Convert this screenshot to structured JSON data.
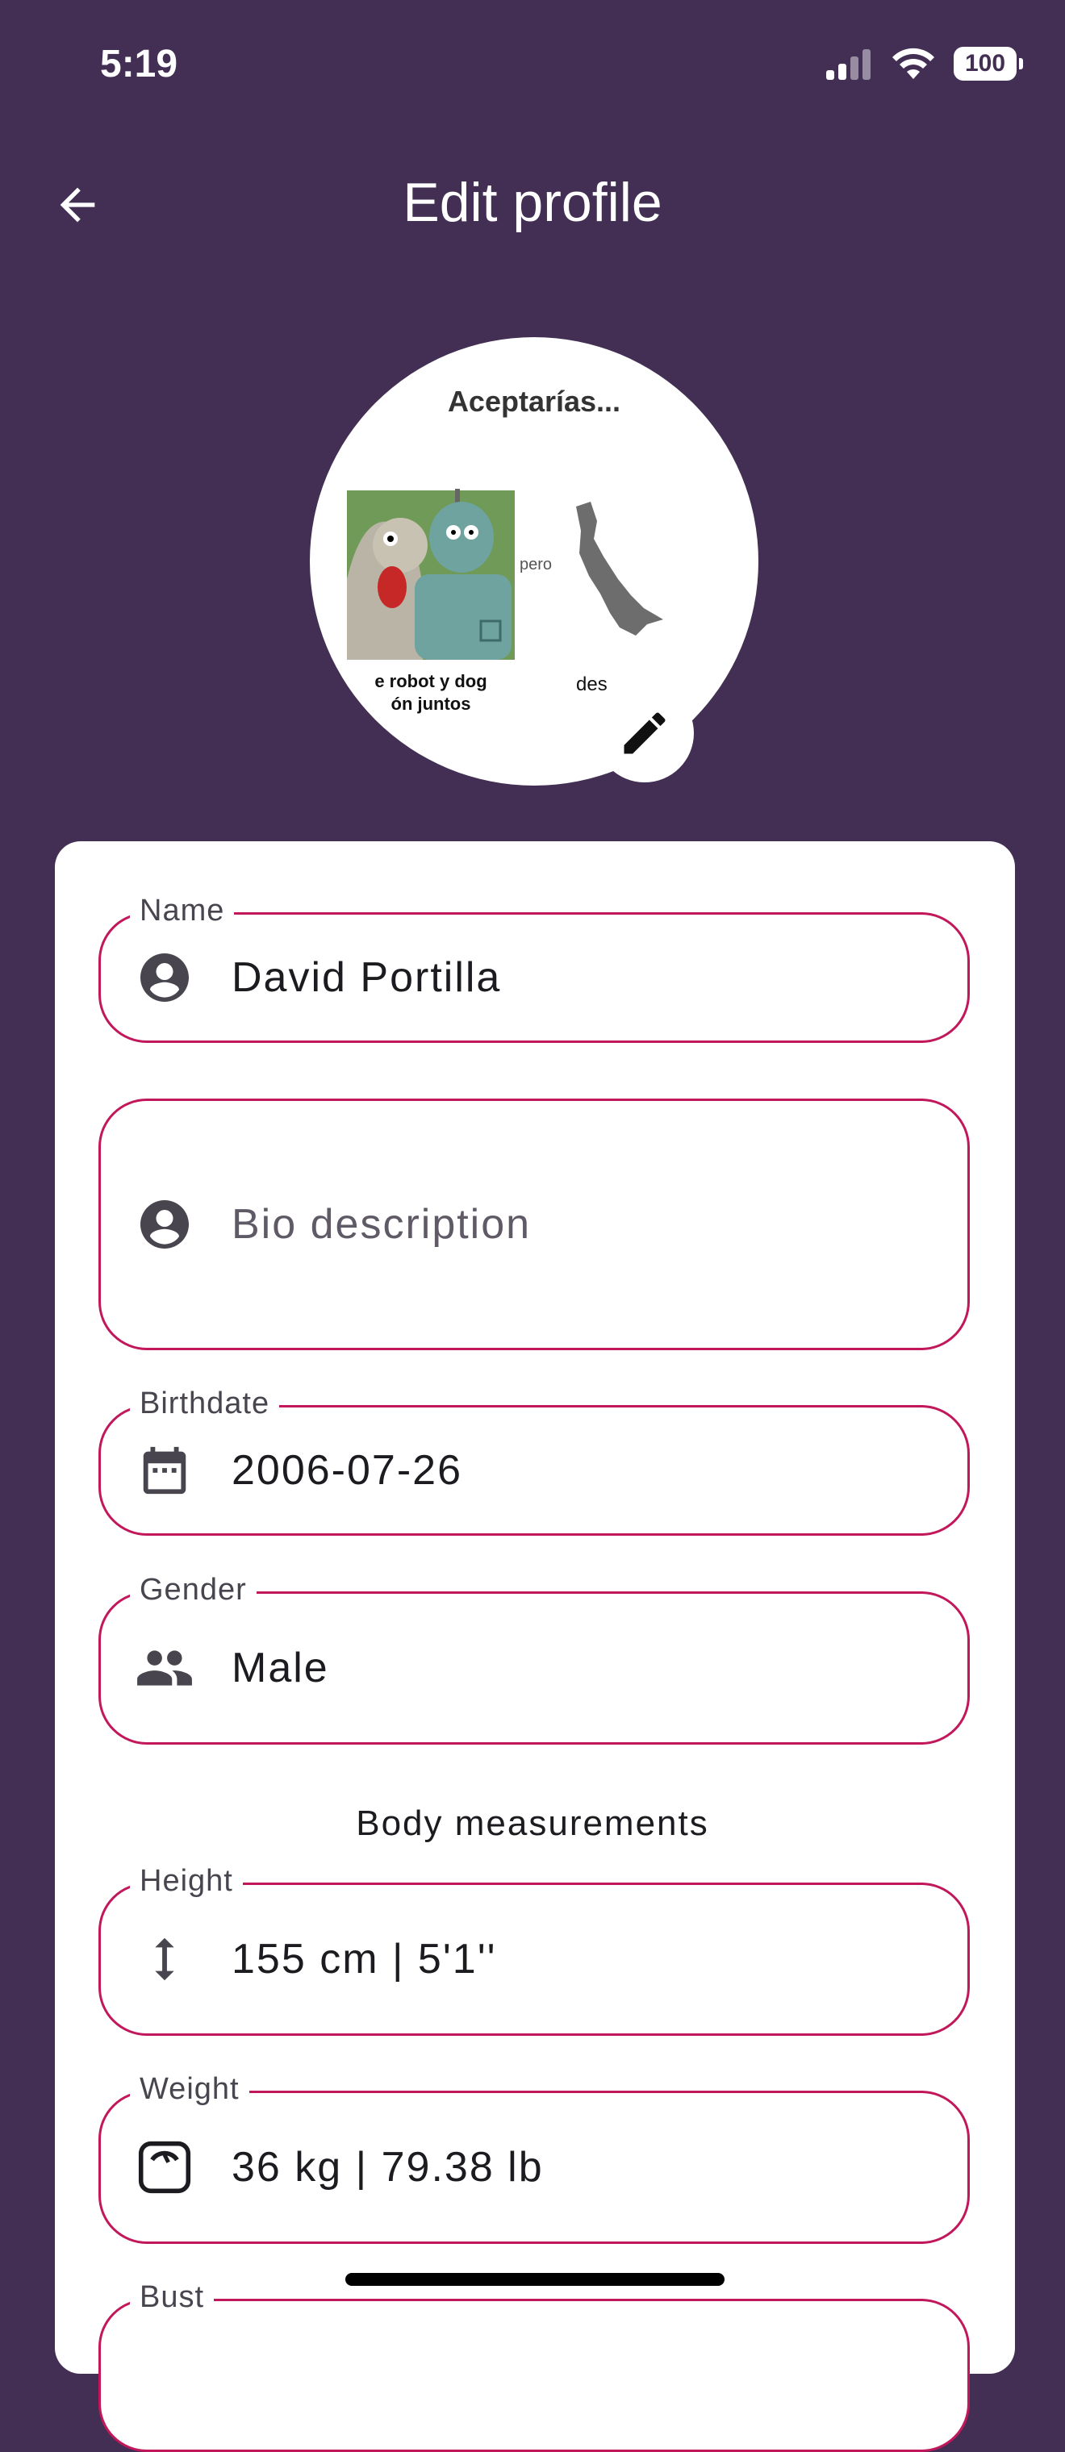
{
  "status_bar": {
    "time": "5:19",
    "battery": "100"
  },
  "app_bar": {
    "title": "Edit profile",
    "back_icon": "arrow-back-icon"
  },
  "avatar": {
    "edit_icon": "pencil-icon",
    "meme_title": "Aceptarías...",
    "meme_connector": "pero",
    "meme_caption_left_1": "e robot y dog",
    "meme_caption_left_2": "ón juntos",
    "meme_caption_right": "des"
  },
  "form": {
    "name": {
      "label": "Name",
      "value": "David Portilla",
      "icon": "account-circle-icon"
    },
    "bio": {
      "placeholder": "Bio description",
      "icon": "account-circle-icon"
    },
    "birthdate": {
      "label": "Birthdate",
      "value": "2006-07-26",
      "icon": "calendar-icon"
    },
    "gender": {
      "label": "Gender",
      "value": "Male",
      "icon": "people-icon"
    },
    "section_title": "Body measurements",
    "height": {
      "label": "Height",
      "value": "155 cm | 5'1''",
      "icon": "vertical-arrows-icon"
    },
    "weight": {
      "label": "Weight",
      "value": "36 kg | 79.38 lb",
      "icon": "scale-icon"
    },
    "bust": {
      "label": "Bust"
    }
  },
  "colors": {
    "background": "#432f54",
    "accent_border": "#c2185b",
    "card": "#ffffff"
  }
}
